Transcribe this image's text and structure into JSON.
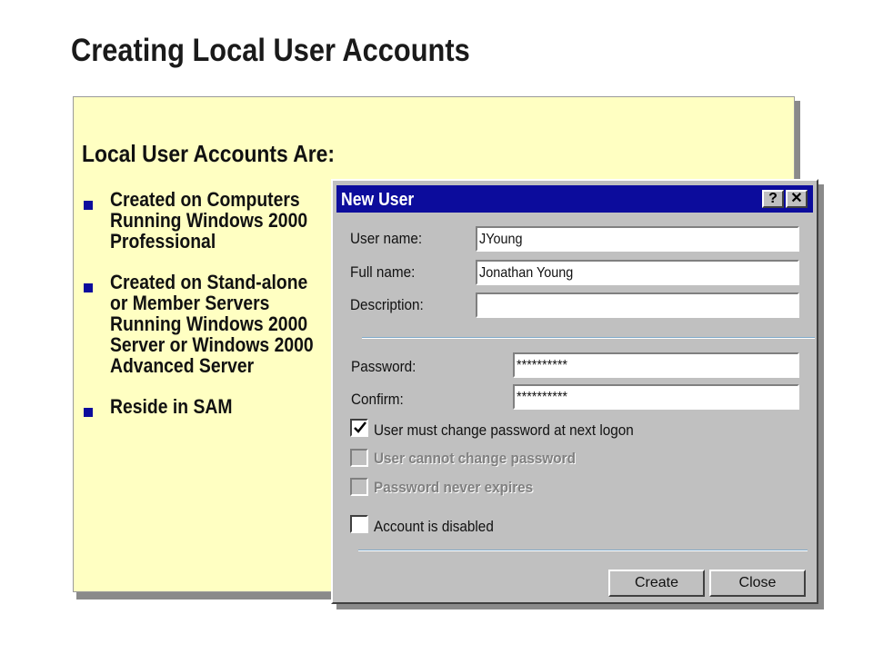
{
  "slide": {
    "title": "Creating Local User Accounts",
    "heading": "Local User Accounts Are:",
    "bullets": [
      "Created on Computers Running Windows 2000 Professional",
      "Created on Stand-alone or Member Servers Running Windows 2000 Server or Windows 2000 Advanced Server",
      "Reside in SAM"
    ]
  },
  "dialog": {
    "title": "New User",
    "help_label": "?",
    "close_label": "✕",
    "fields": {
      "user_name_label": "User name:",
      "user_name_value": "JYoung",
      "full_name_label": "Full name:",
      "full_name_value": "Jonathan Young",
      "description_label": "Description:",
      "description_value": "",
      "password_label": "Password:",
      "password_value": "**********",
      "confirm_label": "Confirm:",
      "confirm_value": "**********"
    },
    "options": [
      {
        "label": "User must change password at next logon",
        "checked": true,
        "enabled": true
      },
      {
        "label": "User cannot change password",
        "checked": false,
        "enabled": false
      },
      {
        "label": "Password never expires",
        "checked": false,
        "enabled": false
      },
      {
        "label": "Account is disabled",
        "checked": false,
        "enabled": true
      }
    ],
    "buttons": {
      "create_label": "Create",
      "close_label": "Close"
    }
  },
  "colors": {
    "panel_background": "#ffffc2",
    "titlebar": "#0c0c9c",
    "bullet": "#0c0c9c",
    "dialog_face": "#c0c0c0"
  }
}
